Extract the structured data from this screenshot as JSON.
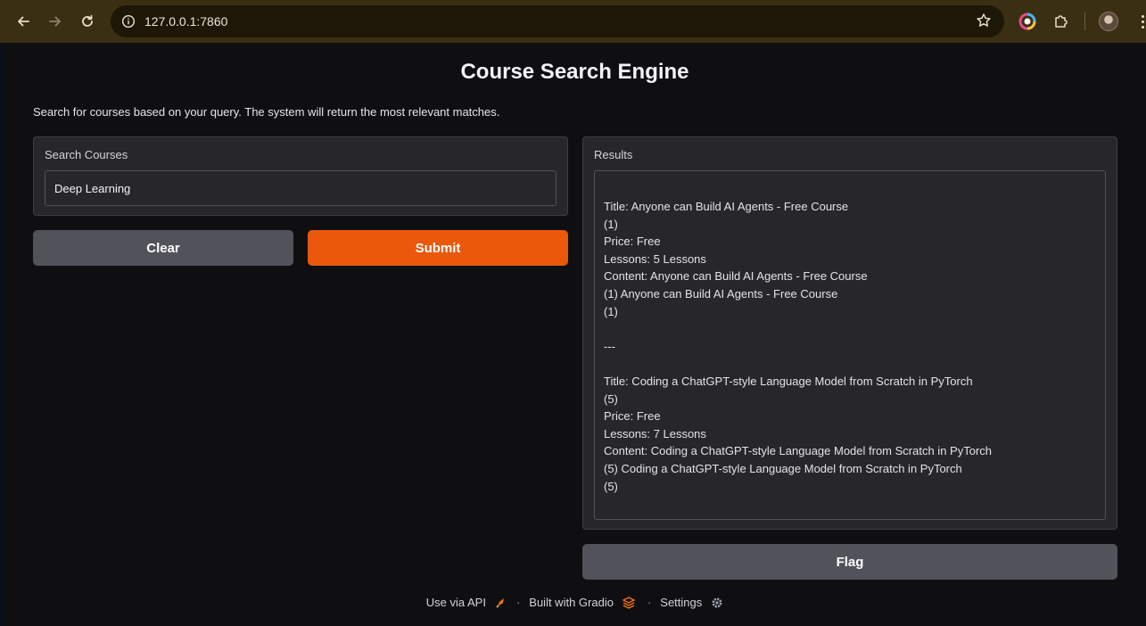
{
  "browser": {
    "url": "127.0.0.1:7860"
  },
  "app": {
    "title": "Course Search Engine",
    "description": "Search for courses based on your query. The system will return the most relevant matches."
  },
  "search": {
    "label": "Search Courses",
    "value": "Deep Learning"
  },
  "buttons": {
    "clear": "Clear",
    "submit": "Submit",
    "flag": "Flag"
  },
  "results": {
    "label": "Results",
    "lines": [
      "Title: Anyone can Build AI Agents - Free Course",
      "(1)",
      "Price: Free",
      "Lessons: 5 Lessons",
      "Content: Anyone can Build AI Agents - Free Course",
      "(1) Anyone can Build AI Agents - Free Course",
      "(1)",
      "",
      "---",
      "",
      "Title: Coding a ChatGPT-style Language Model from Scratch in PyTorch",
      "(5)",
      "Price: Free",
      "Lessons: 7 Lessons",
      "Content: Coding a ChatGPT-style Language Model from Scratch in PyTorch",
      "(5) Coding a ChatGPT-style Language Model from Scratch in PyTorch",
      "(5)"
    ]
  },
  "footer": {
    "api": "Use via API",
    "built": "Built with Gradio",
    "settings": "Settings"
  },
  "colors": {
    "accent": "#ea580c",
    "secondary_button": "#52525b",
    "panel": "#27272a",
    "background": "#0f0f11"
  }
}
